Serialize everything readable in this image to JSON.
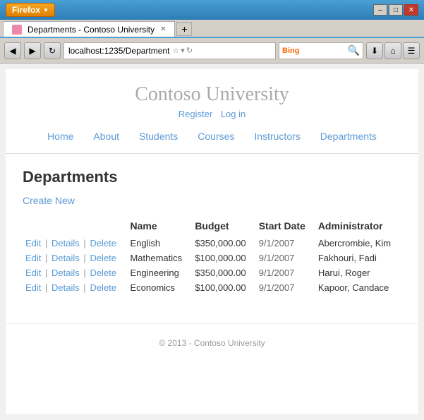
{
  "window": {
    "title": "Departments - Contoso University",
    "firefox_label": "Firefox",
    "new_tab_label": "+",
    "close_label": "✕",
    "minimize_label": "–",
    "maximize_label": "□"
  },
  "addressbar": {
    "url": "localhost:1235/Department",
    "bing_label": "Bing",
    "back_icon": "◀",
    "forward_icon": "▶",
    "refresh_icon": "↻",
    "download_icon": "⬇",
    "home_icon": "⌂",
    "settings_icon": "☰"
  },
  "header": {
    "university_name": "Contoso University",
    "register_label": "Register",
    "login_label": "Log in",
    "nav_items": [
      "Home",
      "About",
      "Students",
      "Courses",
      "Instructors",
      "Departments"
    ]
  },
  "main": {
    "page_title": "Departments",
    "create_new_label": "Create New",
    "table": {
      "columns": [
        "",
        "Name",
        "Budget",
        "Start Date",
        "Administrator"
      ],
      "rows": [
        {
          "actions": [
            "Edit",
            "Details",
            "Delete"
          ],
          "name": "English",
          "budget": "$350,000.00",
          "start_date": "9/1/2007",
          "administrator": "Abercrombie, Kim"
        },
        {
          "actions": [
            "Edit",
            "Details",
            "Delete"
          ],
          "name": "Mathematics",
          "budget": "$100,000.00",
          "start_date": "9/1/2007",
          "administrator": "Fakhouri, Fadi"
        },
        {
          "actions": [
            "Edit",
            "Details",
            "Delete"
          ],
          "name": "Engineering",
          "budget": "$350,000.00",
          "start_date": "9/1/2007",
          "administrator": "Harui, Roger"
        },
        {
          "actions": [
            "Edit",
            "Details",
            "Delete"
          ],
          "name": "Economics",
          "budget": "$100,000.00",
          "start_date": "9/1/2007",
          "administrator": "Kapoor, Candace"
        }
      ]
    }
  },
  "footer": {
    "text": "© 2013 - Contoso University"
  }
}
